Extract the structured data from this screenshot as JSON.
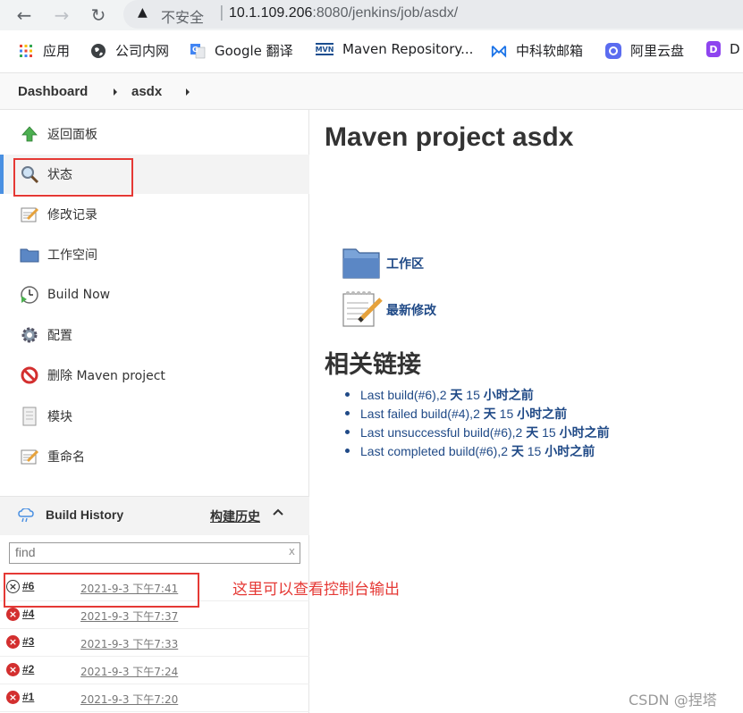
{
  "browser": {
    "security_label": "不安全",
    "url_host": "10.1.109.206",
    "url_rest": ":8080/jenkins/job/asdx/",
    "bookmarks": [
      {
        "label": "应用",
        "icon": "apps-grid-icon"
      },
      {
        "label": "公司内网",
        "icon": "globe-icon"
      },
      {
        "label": "Google 翻译",
        "icon": "google-translate-icon"
      },
      {
        "label": "Maven Repository...",
        "icon": "mvn-icon"
      },
      {
        "label": "中科软邮箱",
        "icon": "mail-icon"
      },
      {
        "label": "阿里云盘",
        "icon": "aliyun-drive-icon"
      },
      {
        "label": "D",
        "icon": "d-icon"
      }
    ]
  },
  "breadcrumb": {
    "items": [
      "Dashboard",
      "asdx"
    ]
  },
  "side_panel": {
    "tasks": [
      {
        "label": "返回面板",
        "icon": "up-arrow-icon"
      },
      {
        "label": "状态",
        "icon": "search-icon"
      },
      {
        "label": "修改记录",
        "icon": "notepad-icon"
      },
      {
        "label": "工作空间",
        "icon": "folder-icon"
      },
      {
        "label": "Build Now",
        "icon": "clock-play-icon"
      },
      {
        "label": "配置",
        "icon": "gear-icon"
      },
      {
        "label": "删除 Maven project",
        "icon": "no-entry-icon"
      },
      {
        "label": "模块",
        "icon": "document-icon"
      },
      {
        "label": "重命名",
        "icon": "notepad-icon"
      }
    ]
  },
  "build_history": {
    "title": "Build History",
    "trend_label": "构建历史",
    "filter_placeholder": "find",
    "filter_clear": "x",
    "builds": [
      {
        "number": "#6",
        "date": "2021-9-3 下午7:41",
        "status": "aborted"
      },
      {
        "number": "#4",
        "date": "2021-9-3 下午7:37",
        "status": "failed"
      },
      {
        "number": "#3",
        "date": "2021-9-3 下午7:33",
        "status": "failed"
      },
      {
        "number": "#2",
        "date": "2021-9-3 下午7:24",
        "status": "failed"
      },
      {
        "number": "#1",
        "date": "2021-9-3 下午7:20",
        "status": "failed"
      }
    ]
  },
  "annotation": "这里可以查看控制台输出",
  "main": {
    "title": "Maven project asdx",
    "workspace_label": "工作区",
    "changes_label": "最新修改",
    "links_title": "相关链接",
    "permalinks": [
      {
        "prefix": "Last build(#6),2 ",
        "bold1": "天",
        "mid": " 15 ",
        "bold2": "小时之前"
      },
      {
        "prefix": "Last failed build(#4),2 ",
        "bold1": "天",
        "mid": " 15 ",
        "bold2": "小时之前"
      },
      {
        "prefix": "Last unsuccessful build(#6),2 ",
        "bold1": "天",
        "mid": " 15 ",
        "bold2": "小时之前"
      },
      {
        "prefix": "Last completed build(#6),2 ",
        "bold1": "天",
        "mid": " 15 ",
        "bold2": "小时之前"
      }
    ]
  },
  "watermark": "CSDN @捏塔",
  "colors": {
    "link": "#204a87",
    "annotation_red": "#e53935",
    "failed_red": "#d32f2f",
    "active_bar": "#4a90e2"
  }
}
